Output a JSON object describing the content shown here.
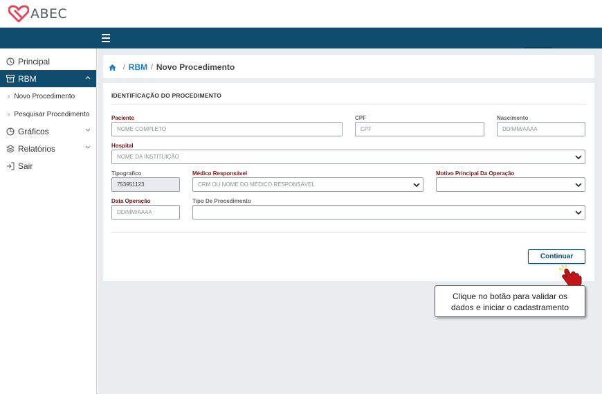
{
  "brand": {
    "name": "ABEC",
    "logo_icon": "heart-ribbon-icon"
  },
  "colors": {
    "nav": "#0f4c6e",
    "label": "#7b1414",
    "link": "#1f7fc8",
    "logo": "#e0475b"
  },
  "sidebar": {
    "items": [
      {
        "label": "Principal",
        "icon": "dashboard-icon"
      },
      {
        "label": "RBM",
        "icon": "archive-icon",
        "active": true,
        "children": [
          {
            "label": "Novo Procedimento"
          },
          {
            "label": "Pesquisar Procedimento"
          }
        ]
      },
      {
        "label": "Gráficos",
        "icon": "pie-chart-icon"
      },
      {
        "label": "Relatórios",
        "icon": "layers-icon"
      },
      {
        "label": "Sair",
        "icon": "logout-icon"
      }
    ]
  },
  "breadcrumb": {
    "home_icon": "home-icon",
    "section": "RBM",
    "current": "Novo Procedimento"
  },
  "form": {
    "section_title": "IDENTIFICAÇÃO DO PROCEDIMENTO",
    "paciente": {
      "label": "Paciente",
      "placeholder": "NOME COMPLETO"
    },
    "cpf": {
      "label": "CPF",
      "placeholder": "CPF"
    },
    "nascimento": {
      "label": "Nascimento",
      "placeholder": "DD/MM/AAAA"
    },
    "hospital": {
      "label": "Hospital",
      "placeholder": "NOME DA INSTITUIÇÃO"
    },
    "tipografico": {
      "label": "Tipografico",
      "value": "753951123"
    },
    "medico": {
      "label": "Médico Responsável",
      "placeholder": "CRM OU NOME DO MÉDICO RESPONSÁVEL"
    },
    "motivo": {
      "label": "Motivo Principal Da Operação",
      "value": ""
    },
    "data_operacao": {
      "label": "Data Operação",
      "placeholder": "DD/MM/AAAA"
    },
    "tipo": {
      "label": "Tipo De Procedimento",
      "value": ""
    },
    "continue_label": "Continuar"
  },
  "tooltip": {
    "line1": "Clique no botão para validar os",
    "line2": "dados e iniciar o cadastramento",
    "pointer_icon": "hand-pointer-icon"
  }
}
